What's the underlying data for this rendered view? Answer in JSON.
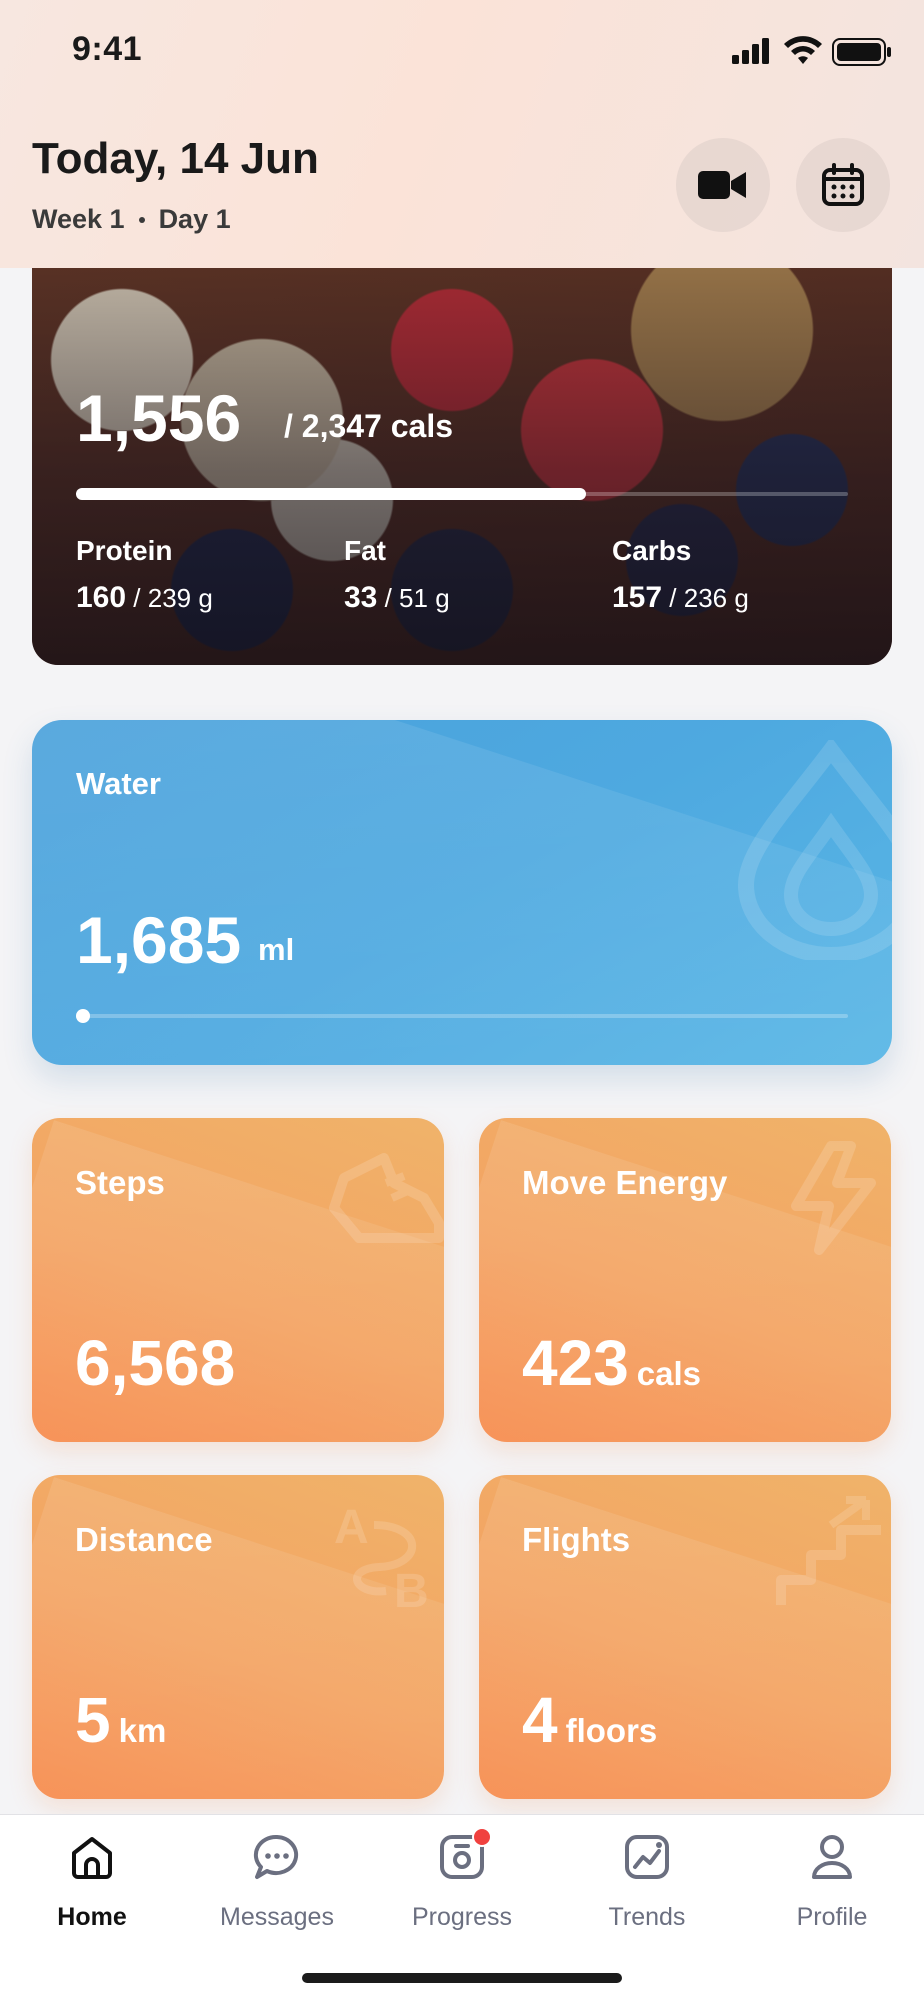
{
  "status_bar": {
    "time": "9:41"
  },
  "header": {
    "date_title": "Today, 14 Jun",
    "week": "Week 1",
    "day": "Day 1"
  },
  "calories": {
    "consumed": "1,556",
    "total_text": "/ 2,347 cals",
    "progress": 0.66,
    "macros": [
      {
        "label": "Protein",
        "value": "160",
        "rest": "/ 239 g"
      },
      {
        "label": "Fat",
        "value": "33",
        "rest": "/ 51 g"
      },
      {
        "label": "Carbs",
        "value": "157",
        "rest": "/ 236 g"
      }
    ]
  },
  "water": {
    "title": "Water",
    "value": "1,685",
    "unit": "ml",
    "progress": 0.01
  },
  "tiles": {
    "steps": {
      "title": "Steps",
      "value": "6,568",
      "unit": ""
    },
    "move": {
      "title": "Move Energy",
      "value": "423",
      "unit": "cals"
    },
    "distance": {
      "title": "Distance",
      "value": "5",
      "unit": "km"
    },
    "flights": {
      "title": "Flights",
      "value": "4",
      "unit": "floors"
    }
  },
  "tabs": [
    {
      "label": "Home",
      "icon": "home-icon",
      "active": true
    },
    {
      "label": "Messages",
      "icon": "messages-icon"
    },
    {
      "label": "Progress",
      "icon": "progress-icon",
      "badge": true
    },
    {
      "label": "Trends",
      "icon": "trends-icon"
    },
    {
      "label": "Profile",
      "icon": "profile-icon"
    }
  ],
  "colors": {
    "water_blue": "#4ea9e0",
    "tile_orange": "#f3a362",
    "badge_red": "#f0413f"
  }
}
